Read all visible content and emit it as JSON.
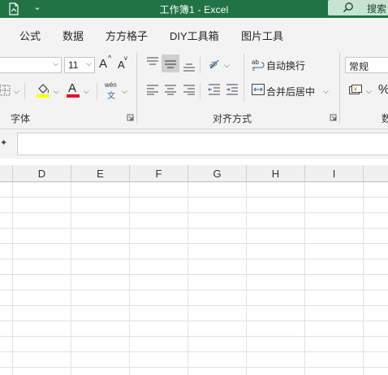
{
  "titlebar": {
    "title": "工作簿1  -  Excel",
    "quick_access_dropdown": "⌄",
    "search_label": "搜索"
  },
  "ribbon_tabs": [
    "公式",
    "数据",
    "方方格子",
    "DIY工具箱",
    "图片工具"
  ],
  "font": {
    "font_name": "",
    "font_size": "11",
    "grow_label": "A",
    "shrink_label": "A",
    "font_color_label": "A",
    "phonetic_top": "wén",
    "phonetic_bottom": "文",
    "highlight_color": "#ffff00",
    "font_color": "#e81123",
    "group_label": "字体"
  },
  "alignment": {
    "wrap_text_label": "自动换行",
    "merge_center_label": "合并后居中",
    "group_label": "对齐方式"
  },
  "number": {
    "format_value": "常规",
    "percent_label": "%",
    "group_label": "数"
  },
  "columns": [
    "D",
    "E",
    "F",
    "G",
    "H",
    "I"
  ],
  "colors": {
    "titlebar": "#217346",
    "search_bg": "#c7e4d3"
  }
}
